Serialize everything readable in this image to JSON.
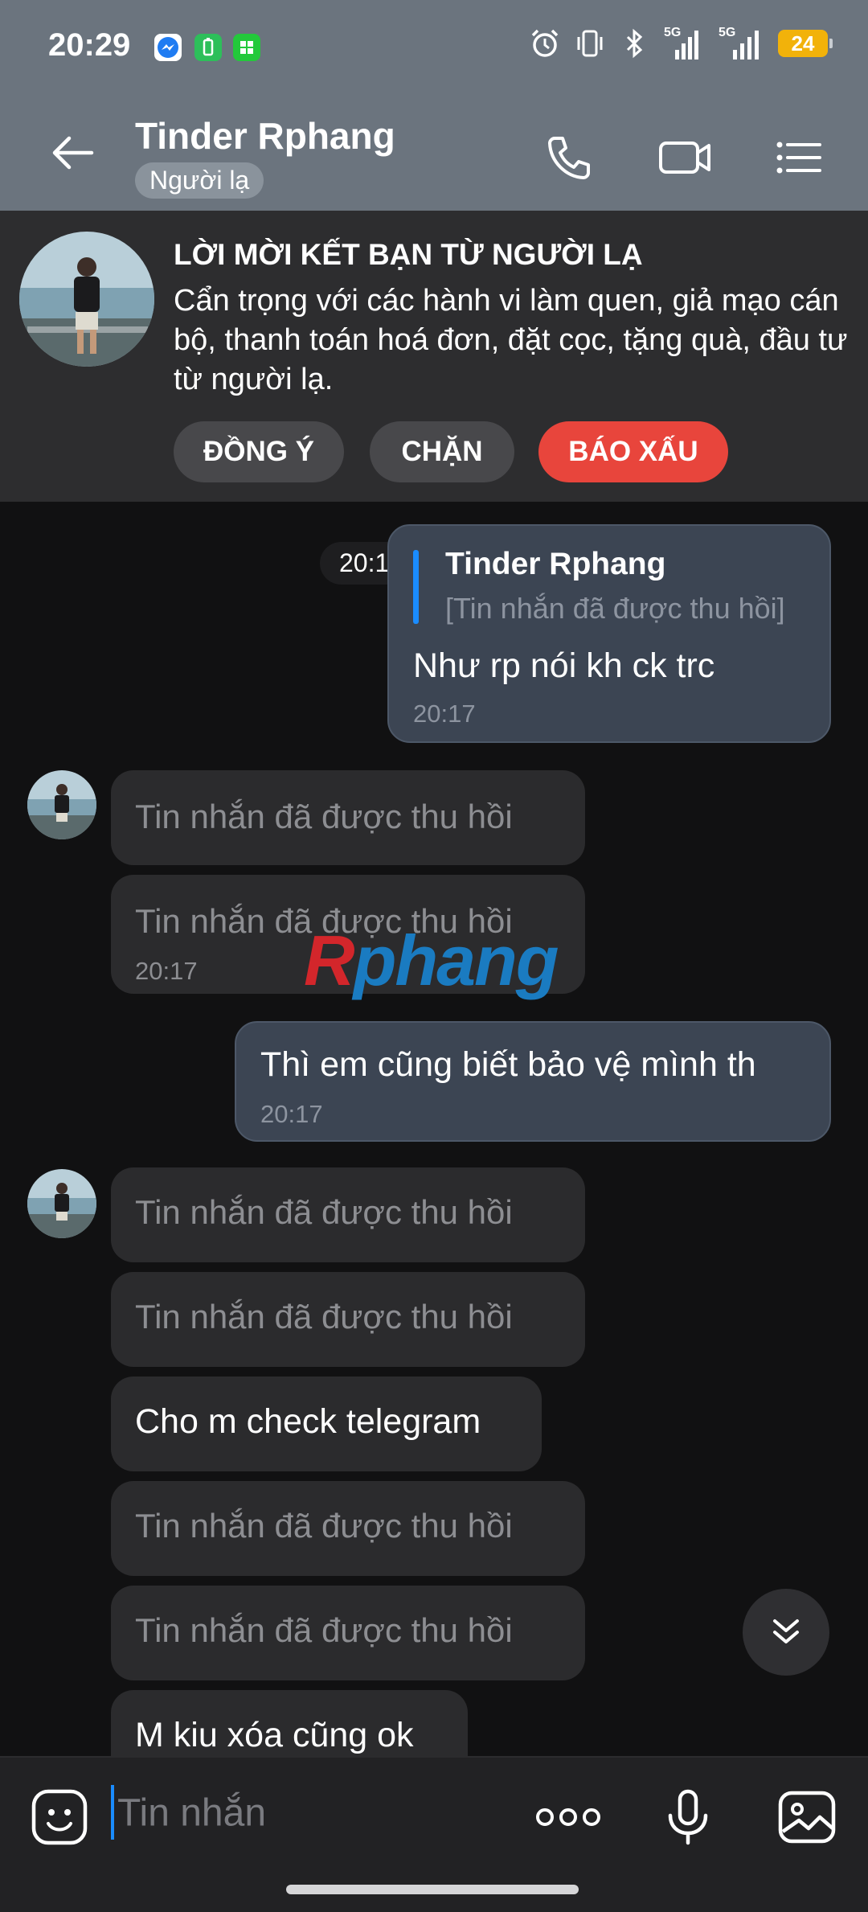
{
  "status_bar": {
    "time": "20:29",
    "battery": "24",
    "network_1": "5G",
    "network_2": "5G",
    "icons": [
      "messenger-icon",
      "battery-app-icon",
      "green-app-icon",
      "alarm-icon",
      "vibrate-icon",
      "bluetooth-icon",
      "signal-icon",
      "signal-icon"
    ]
  },
  "header": {
    "title": "Tinder Rphang",
    "tag": "Người lạ",
    "icons": [
      "back-arrow-icon",
      "phone-icon",
      "video-call-icon",
      "menu-list-icon"
    ]
  },
  "stranger_banner": {
    "title": "LỜI MỜI KẾT BẠN TỪ NGƯỜI LẠ",
    "warning": "Cẩn trọng với các hành vi làm quen, giả mạo cán bộ, thanh toán hoá đơn, đặt cọc, tặng quà, đầu tư từ người lạ.",
    "accept_label": "ĐỒNG Ý",
    "block_label": "CHẶN",
    "report_label": "BÁO XẤU",
    "report_color": "#e8453c"
  },
  "chat": {
    "time_separator": "20:17 Hôm nay",
    "messages": [
      {
        "direction": "out",
        "quote_author": "Tinder Rphang",
        "quote_text": "[Tin nhắn đã được thu hồi]",
        "text": "Như rp nói kh ck trc",
        "time": "20:17"
      },
      {
        "direction": "in",
        "text": "Tin nhắn đã được thu hồi",
        "recalled": true
      },
      {
        "direction": "in",
        "text": "Tin nhắn đã được thu hồi",
        "recalled": true,
        "time": "20:17"
      },
      {
        "direction": "out",
        "text": "Thì em cũng biết bảo vệ mình th",
        "time": "20:17"
      },
      {
        "direction": "in",
        "text": "Tin nhắn đã được thu hồi",
        "recalled": true
      },
      {
        "direction": "in",
        "text": "Tin nhắn đã được thu hồi",
        "recalled": true
      },
      {
        "direction": "in",
        "text": "Cho m check telegram"
      },
      {
        "direction": "in",
        "text": "Tin nhắn đã được thu hồi",
        "recalled": true
      },
      {
        "direction": "in",
        "text": "Tin nhắn đã được thu hồi",
        "recalled": true
      },
      {
        "direction": "in",
        "text": "M kiu xóa cũng ok"
      }
    ],
    "watermark": {
      "first": "R",
      "rest": "phang"
    }
  },
  "input_bar": {
    "placeholder": "Tin nhắn",
    "icons": [
      "sticker-icon",
      "more-dots-icon",
      "microphone-icon",
      "image-icon"
    ]
  }
}
